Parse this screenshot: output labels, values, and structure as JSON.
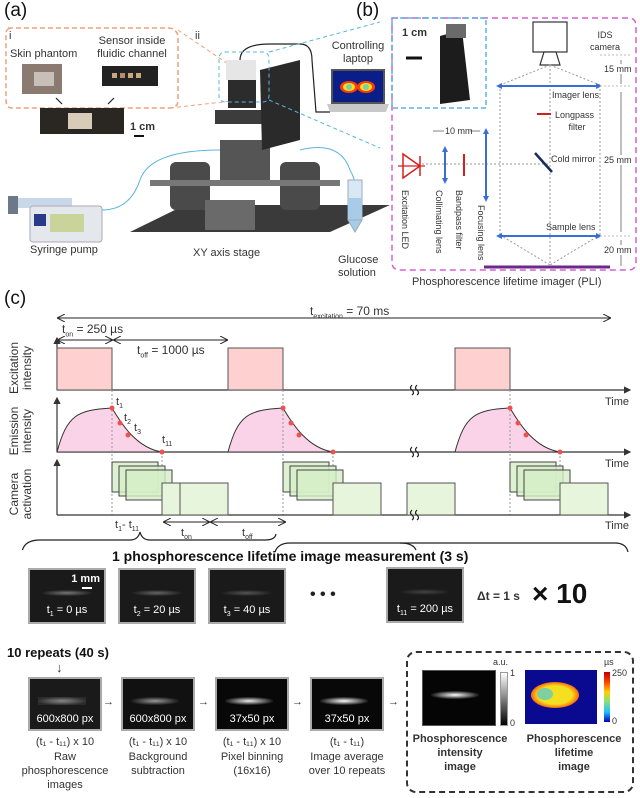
{
  "panels": {
    "a": {
      "letter": "(a)",
      "inset_i_label": "i",
      "inset_ii_label": "ii",
      "skin_phantom": "Skin phantom",
      "sensor_line1": "Sensor inside",
      "sensor_line2": "fluidic channel",
      "scale_1cm": "1 cm",
      "controlling_line1": "Controlling",
      "controlling_line2": "laptop",
      "syringe_pump": "Syringe pump",
      "xy_stage": "XY axis stage",
      "glucose_line1": "Glucose",
      "glucose_line2": "solution"
    },
    "b": {
      "letter": "(b)",
      "scale_1cm": "1 cm",
      "ids_line1": "IDS",
      "ids_line2": "camera",
      "dim_15": "15 mm",
      "dim_25": "25 mm",
      "dim_20": "20 mm",
      "dim_10": "10 mm",
      "imager_lens": "Imager lens",
      "longpass_line1": "Longpass",
      "longpass_line2": "filter",
      "cold_mirror": "Cold mirror",
      "sample_lens": "Sample lens",
      "excitation_led": "Excitation LED",
      "collimating_lens": "Collimating lens",
      "bandpass_filter": "Bandpass filter",
      "focusing_lens": "Focusing lens",
      "caption": "Phosphorescence lifetime imager (PLI)"
    },
    "c": {
      "letter": "(c)",
      "t_excitation": "t",
      "t_excitation_sub": "excitation",
      "t_excitation_val": " = 70 ms",
      "t_on_label": "t",
      "t_on_sub": "on",
      "t_on_val": " = 250 µs",
      "t_off_label": "t",
      "t_off_sub": "off",
      "t_off_val": " = 1000 µs",
      "y_excitation_1": "Excitation",
      "y_excitation_2": "intensity",
      "y_emission_1": "Emission",
      "y_emission_2": "intensity",
      "y_camera_1": "Camera",
      "y_camera_2": "activation",
      "time_label": "Time",
      "points": [
        "t1",
        "t2",
        "t3",
        "t11"
      ],
      "range_label": "t1 - t11",
      "ton_short": "on",
      "toff_short": "off",
      "measurement_title": "1 phosphorescence lifetime image measurement (3 s)",
      "scale_1mm": "1 mm",
      "frames": [
        {
          "sub": "1",
          "val": " = 0 µs"
        },
        {
          "sub": "2",
          "val": " = 20 µs"
        },
        {
          "sub": "3",
          "val": " = 40 µs"
        },
        {
          "sub": "11",
          "val": " = 200 µs"
        }
      ],
      "ellipsis": "• • •",
      "delta_t": "Δt = 1 s",
      "times_ten": "× 10",
      "repeats_title": "10 repeats (40 s)",
      "pipeline": [
        {
          "size": "600x800 px",
          "range": "(t₁ - t₁₁) x 10",
          "desc1": "Raw",
          "desc2": "phosphorescence",
          "desc3": "images"
        },
        {
          "size": "600x800 px",
          "range": "(t₁ - t₁₁) x 10",
          "desc1": "Background",
          "desc2": "subtraction",
          "desc3": ""
        },
        {
          "size": "37x50 px",
          "range": "(t₁ - t₁₁) x 10",
          "desc1": "Pixel binning",
          "desc2": "(16x16)",
          "desc3": ""
        },
        {
          "size": "37x50 px",
          "range": "(t₁ - t₁₁)",
          "desc1": "Image average",
          "desc2": "over 10 repeats",
          "desc3": ""
        }
      ],
      "intensity_unit": "a.u.",
      "intensity_max": "1",
      "intensity_min": "0",
      "lifetime_unit": "µs",
      "lifetime_max": "250",
      "lifetime_min": "0",
      "intensity_title_1": "Phosphorescence",
      "intensity_title_2": "intensity",
      "intensity_title_3": "image",
      "lifetime_title_1": "Phosphorescence",
      "lifetime_title_2": "lifetime",
      "lifetime_title_3": "image"
    }
  },
  "colors": {
    "orange_dash": "#f0a07a",
    "blue_dash": "#5ab4e0",
    "magenta_dash": "#d060d0",
    "pulse_fill": "#ffd0d0",
    "emission_fill": "#fbd3e9",
    "camera_fill": "#d6efc8",
    "lens_blue": "#3a6fd0",
    "led_red": "#d62020",
    "sample_purple": "#6a2a8a"
  }
}
